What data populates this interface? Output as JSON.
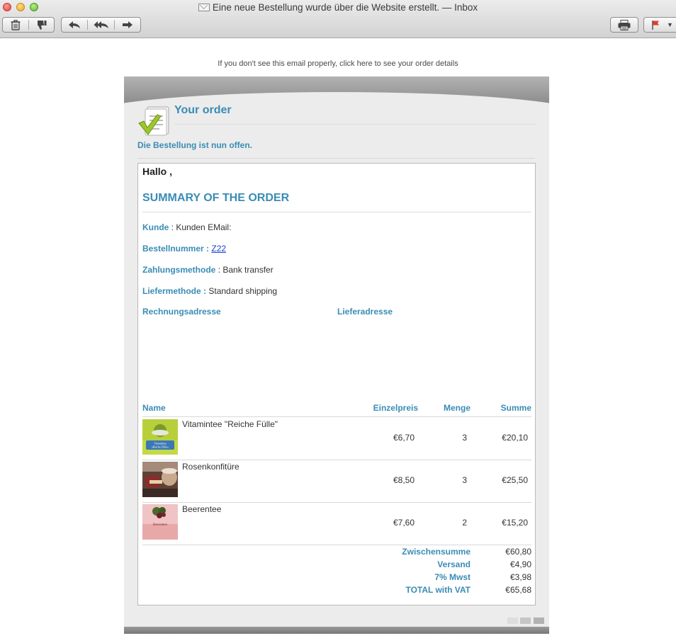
{
  "window": {
    "title": "Eine neue Bestellung wurde über die Website erstellt. — Inbox",
    "toolbar_icons": [
      "trash-icon",
      "junk-icon",
      "reply-icon",
      "reply-all-icon",
      "forward-icon",
      "print-icon",
      "flag-icon"
    ]
  },
  "email": {
    "preheader": "If you don't see this email properly, click here to see your order details",
    "header_title": "Your order",
    "status": "Die Bestellung ist nun offen.",
    "greeting": "Hallo ,",
    "summary_title": "SUMMARY OF THE ORDER",
    "fields": {
      "kunde_label": "Kunde",
      "kunde_value": "Kunden EMail:",
      "bestellnummer_label": "Bestellnummer",
      "bestellnummer_value": "Z22",
      "zahlung_label": "Zahlungsmethode",
      "zahlung_value": "Bank transfer",
      "liefer_label": "Liefermethode",
      "liefer_value": "Standard shipping",
      "separator": " : "
    },
    "billing_address_label": "Rechnungsadresse",
    "shipping_address_label": "Lieferadresse",
    "table": {
      "headers": {
        "name": "Name",
        "price": "Einzelpreis",
        "qty": "Menge",
        "sum": "Summe"
      },
      "items": [
        {
          "name": "Vitamintee \"Reiche Fülle\"",
          "price": "€6,70",
          "qty": "3",
          "sum": "€20,10",
          "thumb_label": "Vitamintee «Reiche Fülle»",
          "thumb_color": "#a8c43a"
        },
        {
          "name": "Rosenkonfitüre",
          "price": "€8,50",
          "qty": "3",
          "sum": "€25,50",
          "thumb_color": "#6b4a3a"
        },
        {
          "name": "Beerentee",
          "price": "€7,60",
          "qty": "2",
          "sum": "€15,20",
          "thumb_label": "Beerentee",
          "thumb_color": "#e9b8b8"
        }
      ]
    },
    "totals": [
      {
        "label": "Zwischensumme",
        "value": "€60,80"
      },
      {
        "label": "Versand",
        "value": "€4,90"
      },
      {
        "label": "7% Mwst",
        "value": "€3,98"
      },
      {
        "label": "TOTAL with VAT",
        "value": "€65,68"
      }
    ],
    "colors": {
      "accent": "#3a8cb4",
      "card_bg": "#ececec"
    }
  }
}
